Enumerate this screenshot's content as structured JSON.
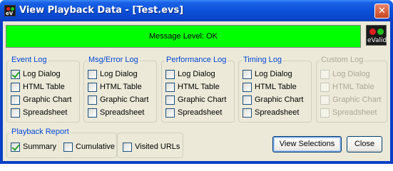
{
  "window": {
    "title": "View Playback Data - [Test.evs]",
    "app_icon_text": "eV",
    "close_symbol": "✕"
  },
  "message": {
    "text": "Message Level: OK",
    "color": "#00ff00"
  },
  "logo": {
    "text": "eValid"
  },
  "groups": [
    {
      "title": "Event Log",
      "enabled": true,
      "items": [
        {
          "label": "Log Dialog",
          "checked": true
        },
        {
          "label": "HTML Table",
          "checked": false
        },
        {
          "label": "Graphic Chart",
          "checked": false
        },
        {
          "label": "Spreadsheet",
          "checked": false
        }
      ]
    },
    {
      "title": "Msg/Error Log",
      "enabled": true,
      "items": [
        {
          "label": "Log Dialog",
          "checked": false
        },
        {
          "label": "HTML Table",
          "checked": false
        },
        {
          "label": "Graphic Chart",
          "checked": false
        },
        {
          "label": "Spreadsheet",
          "checked": false
        }
      ]
    },
    {
      "title": "Performance Log",
      "enabled": true,
      "items": [
        {
          "label": "Log Dialog",
          "checked": false
        },
        {
          "label": "HTML Table",
          "checked": false
        },
        {
          "label": "Graphic Chart",
          "checked": false
        },
        {
          "label": "Spreadsheet",
          "checked": false
        }
      ]
    },
    {
      "title": "Timing Log",
      "enabled": true,
      "items": [
        {
          "label": "Log Dialog",
          "checked": false
        },
        {
          "label": "HTML Table",
          "checked": false
        },
        {
          "label": "Graphic Chart",
          "checked": false
        },
        {
          "label": "Spreadsheet",
          "checked": false
        }
      ]
    },
    {
      "title": "Custom Log",
      "enabled": false,
      "items": [
        {
          "label": "Log Dialog",
          "checked": false
        },
        {
          "label": "HTML Table",
          "checked": false
        },
        {
          "label": "Graphic Chart",
          "checked": false
        },
        {
          "label": "Spreadsheet",
          "checked": false
        }
      ]
    }
  ],
  "playback_report": {
    "title": "Playback Report",
    "summary": {
      "label": "Summary",
      "checked": true
    },
    "cumulative": {
      "label": "Cumulative",
      "checked": false
    }
  },
  "visited_urls": {
    "label": "Visited URLs",
    "checked": false
  },
  "buttons": {
    "view_selections": "View Selections",
    "close": "Close"
  }
}
